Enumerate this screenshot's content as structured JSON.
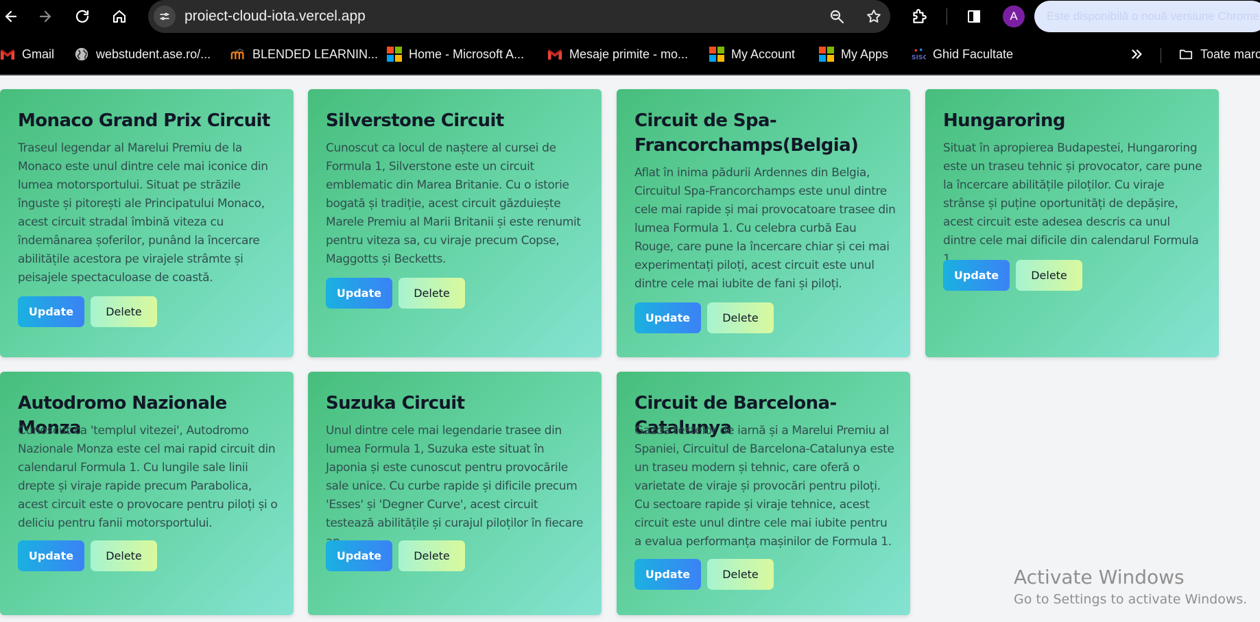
{
  "browser": {
    "url": "proiect-cloud-iota.vercel.app",
    "avatar_letter": "A",
    "update_notice": "Este disponibilă o nouă versiune Chrome",
    "accent_color": "#7b1fa2"
  },
  "bookmarks": {
    "items": [
      {
        "label": "Gmail",
        "icon": "gmail-icon"
      },
      {
        "label": "webstudent.ase.ro/...",
        "icon": "globe-icon"
      },
      {
        "label": "BLENDED LEARNIN...",
        "icon": "moodle-icon"
      },
      {
        "label": "Home - Microsoft A...",
        "icon": "microsoft-icon"
      },
      {
        "label": "Mesaje primite - mo...",
        "icon": "gmail-icon"
      },
      {
        "label": "My Account",
        "icon": "microsoft-icon"
      },
      {
        "label": "My Apps",
        "icon": "microsoft-icon"
      },
      {
        "label": "Ghid Facultate",
        "icon": "sisc-icon"
      }
    ],
    "folder_label": "Toate marcajele"
  },
  "circuits": [
    {
      "title": "Monaco Grand Prix Circuit",
      "description": "Traseul legendar al Marelui Premiu de la Monaco este unul dintre cele mai iconice din lumea motorsportului. Situat pe străzile înguste și pitorești ale Principatului Monaco, acest circuit stradal îmbină viteza cu îndemânarea șoferilor, punând la încercare abilitățile acestora pe virajele strâmte și peisajele spectaculoase de coastă.",
      "update_label": "Update",
      "delete_label": "Delete"
    },
    {
      "title": "Silverstone Circuit",
      "description": "Cunoscut ca locul de naștere al cursei de Formula 1, Silverstone este un circuit emblematic din Marea Britanie. Cu o istorie bogată și tradiție, acest circuit găzduiește Marele Premiu al Marii Britanii și este renumit pentru viteza sa, cu viraje precum Copse, Maggotts și Becketts.",
      "update_label": "Update",
      "delete_label": "Delete"
    },
    {
      "title": "Circuit de Spa-Francorchamps(Belgia)",
      "description": "Aflat în inima pădurii Ardennes din Belgia, Circuitul Spa-Francorchamps este unul dintre cele mai rapide și mai provocatoare trasee din lumea Formula 1. Cu celebra curbă Eau Rouge, care pune la încercare chiar și cei mai experimentați piloți, acest circuit este unul dintre cele mai iubite de fani și piloți.",
      "update_label": "Update",
      "delete_label": "Delete"
    },
    {
      "title": "Hungaroring",
      "description": "Situat în apropierea Budapestei, Hungaroring este un traseu tehnic și provocator, care pune la încercare abilitățile piloților. Cu viraje strânse și puține oportunități de depășire, acest circuit este adesea descris ca unul dintre cele mai dificile din calendarul Formula 1.",
      "update_label": "Update",
      "delete_label": "Delete"
    },
    {
      "title": "Autodromo Nazionale Monza",
      "description": "Cunoscut ca 'templul vitezei', Autodromo Nazionale Monza este cel mai rapid circuit din calendarul Formula 1. Cu lungile sale linii drepte și viraje rapide precum Parabolica, acest circuit este o provocare pentru piloți și o deliciu pentru fanii motorsportului.",
      "update_label": "Update",
      "delete_label": "Delete"
    },
    {
      "title": "Suzuka Circuit",
      "description": "Unul dintre cele mai legendarie trasee din lumea Formula 1, Suzuka este situat în Japonia și este cunoscut pentru provocările sale unice. Cu curbe rapide și dificile precum 'Esses' și 'Degner Curve', acest circuit testează abilitățile și curajul piloților în fiecare an.",
      "update_label": "Update",
      "delete_label": "Delete"
    },
    {
      "title": "Circuit de Barcelona-Catalunya",
      "description": "Gazda testelor de iarnă și a Marelui Premiu al Spaniei, Circuitul de Barcelona-Catalunya este un traseu modern și tehnic, care oferă o varietate de viraje și provocări pentru piloți. Cu sectoare rapide și viraje tehnice, acest circuit este unul dintre cele mai iubite pentru a evalua performanța mașinilor de Formula 1.",
      "update_label": "Update",
      "delete_label": "Delete"
    }
  ],
  "watermark": {
    "title": "Activate Windows",
    "subtitle": "Go to Settings to activate Windows."
  }
}
